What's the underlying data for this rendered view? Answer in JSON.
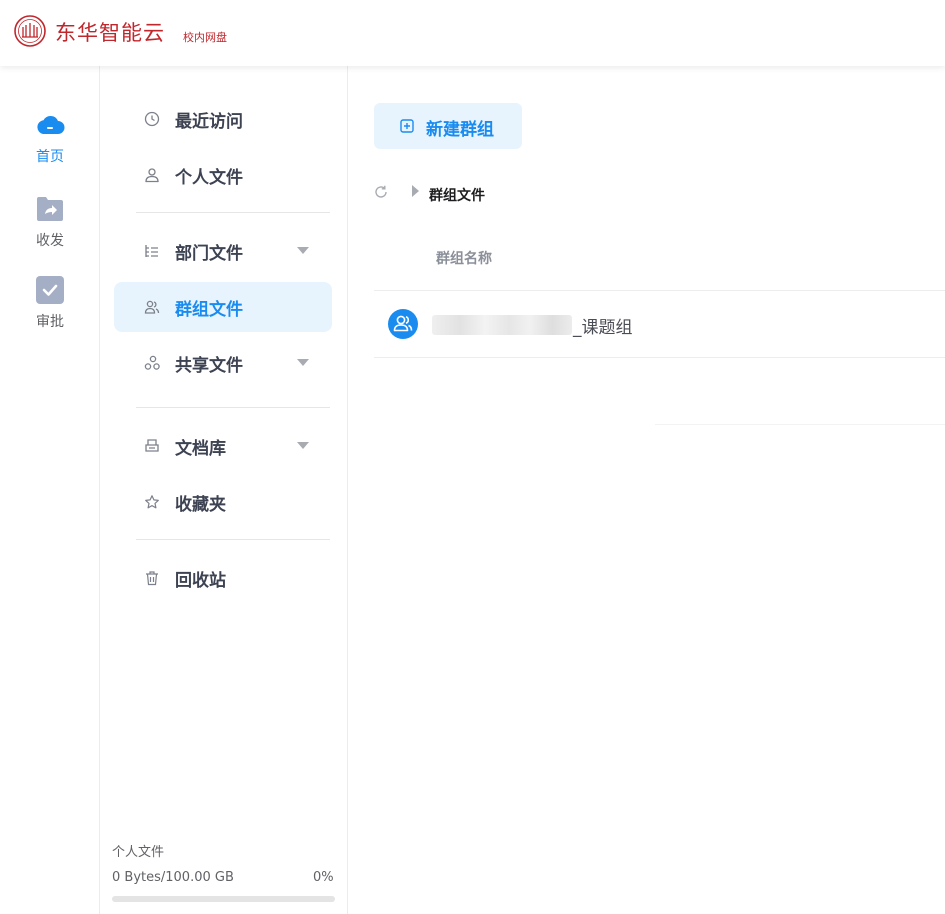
{
  "header": {
    "title": "东华智能云",
    "subtitle": "校内网盘",
    "brand_color": "#c0272d"
  },
  "rail": {
    "items": [
      {
        "label": "首页",
        "icon": "cloud-icon",
        "active": true
      },
      {
        "label": "收发",
        "icon": "folder-share-icon",
        "active": false
      },
      {
        "label": "审批",
        "icon": "checkbox-icon",
        "active": false
      }
    ]
  },
  "nav": {
    "items": [
      {
        "label": "最近访问",
        "icon": "clock-icon"
      },
      {
        "label": "个人文件",
        "icon": "user-icon"
      },
      {
        "label": "部门文件",
        "icon": "org-tree-icon",
        "expandable": true
      },
      {
        "label": "群组文件",
        "icon": "group-icon",
        "active": true
      },
      {
        "label": "共享文件",
        "icon": "share-nodes-icon",
        "expandable": true
      },
      {
        "label": "文档库",
        "icon": "printer-icon",
        "expandable": true
      },
      {
        "label": "收藏夹",
        "icon": "star-icon"
      },
      {
        "label": "回收站",
        "icon": "trash-icon"
      }
    ],
    "quota": {
      "label": "个人文件",
      "used_text": "0 Bytes/100.00 GB",
      "percent_text": "0%",
      "percent": 0
    }
  },
  "main": {
    "new_group_label": "新建群组",
    "breadcrumb": "群组文件",
    "column_header": "群组名称",
    "rows": [
      {
        "name_suffix": "_课题组",
        "icon": "group-avatar-icon"
      }
    ]
  },
  "colors": {
    "accent": "#1a8cf0",
    "active_bg": "#e8f4fd"
  }
}
